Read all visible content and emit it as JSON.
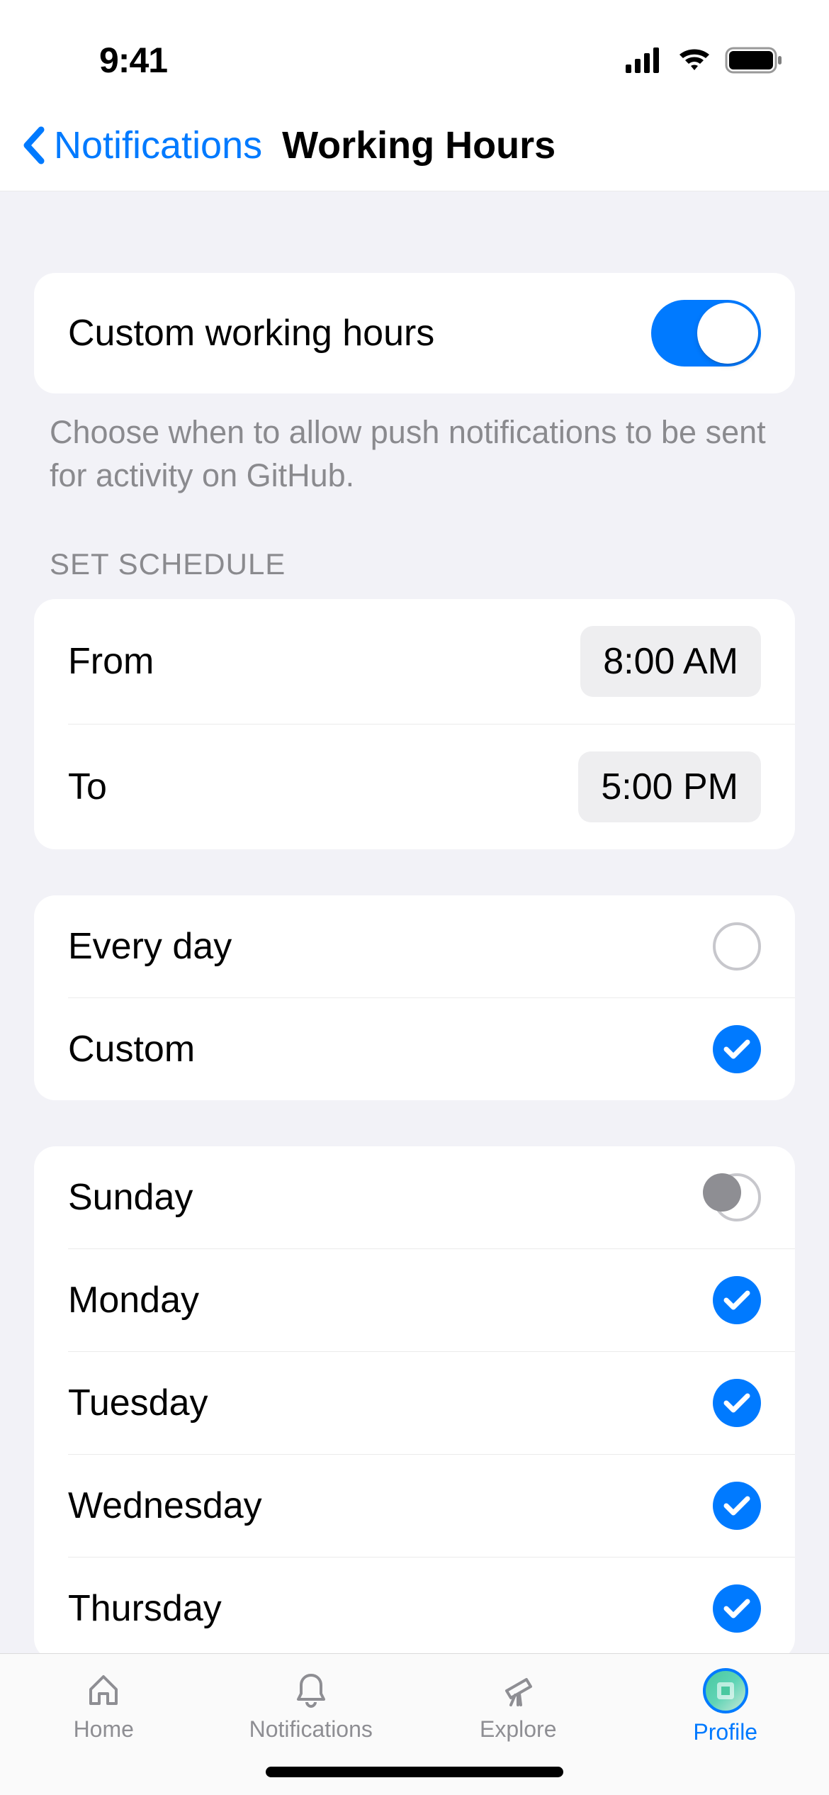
{
  "statusBar": {
    "time": "9:41"
  },
  "nav": {
    "backLabel": "Notifications",
    "title": "Working Hours"
  },
  "toggleSection": {
    "label": "Custom working hours",
    "enabled": true
  },
  "helperText": "Choose when to allow push notifications to be sent for activity on GitHub.",
  "scheduleHeader": "SET SCHEDULE",
  "schedule": {
    "fromLabel": "From",
    "fromTime": "8:00 AM",
    "toLabel": "To",
    "toTime": "5:00 PM"
  },
  "modeOptions": {
    "everyDay": {
      "label": "Every day",
      "selected": false
    },
    "custom": {
      "label": "Custom",
      "selected": true
    }
  },
  "days": [
    {
      "label": "Sunday",
      "selected": false,
      "special": true
    },
    {
      "label": "Monday",
      "selected": true
    },
    {
      "label": "Tuesday",
      "selected": true
    },
    {
      "label": "Wednesday",
      "selected": true
    },
    {
      "label": "Thursday",
      "selected": true
    }
  ],
  "tabBar": {
    "home": "Home",
    "notifications": "Notifications",
    "explore": "Explore",
    "profile": "Profile"
  }
}
